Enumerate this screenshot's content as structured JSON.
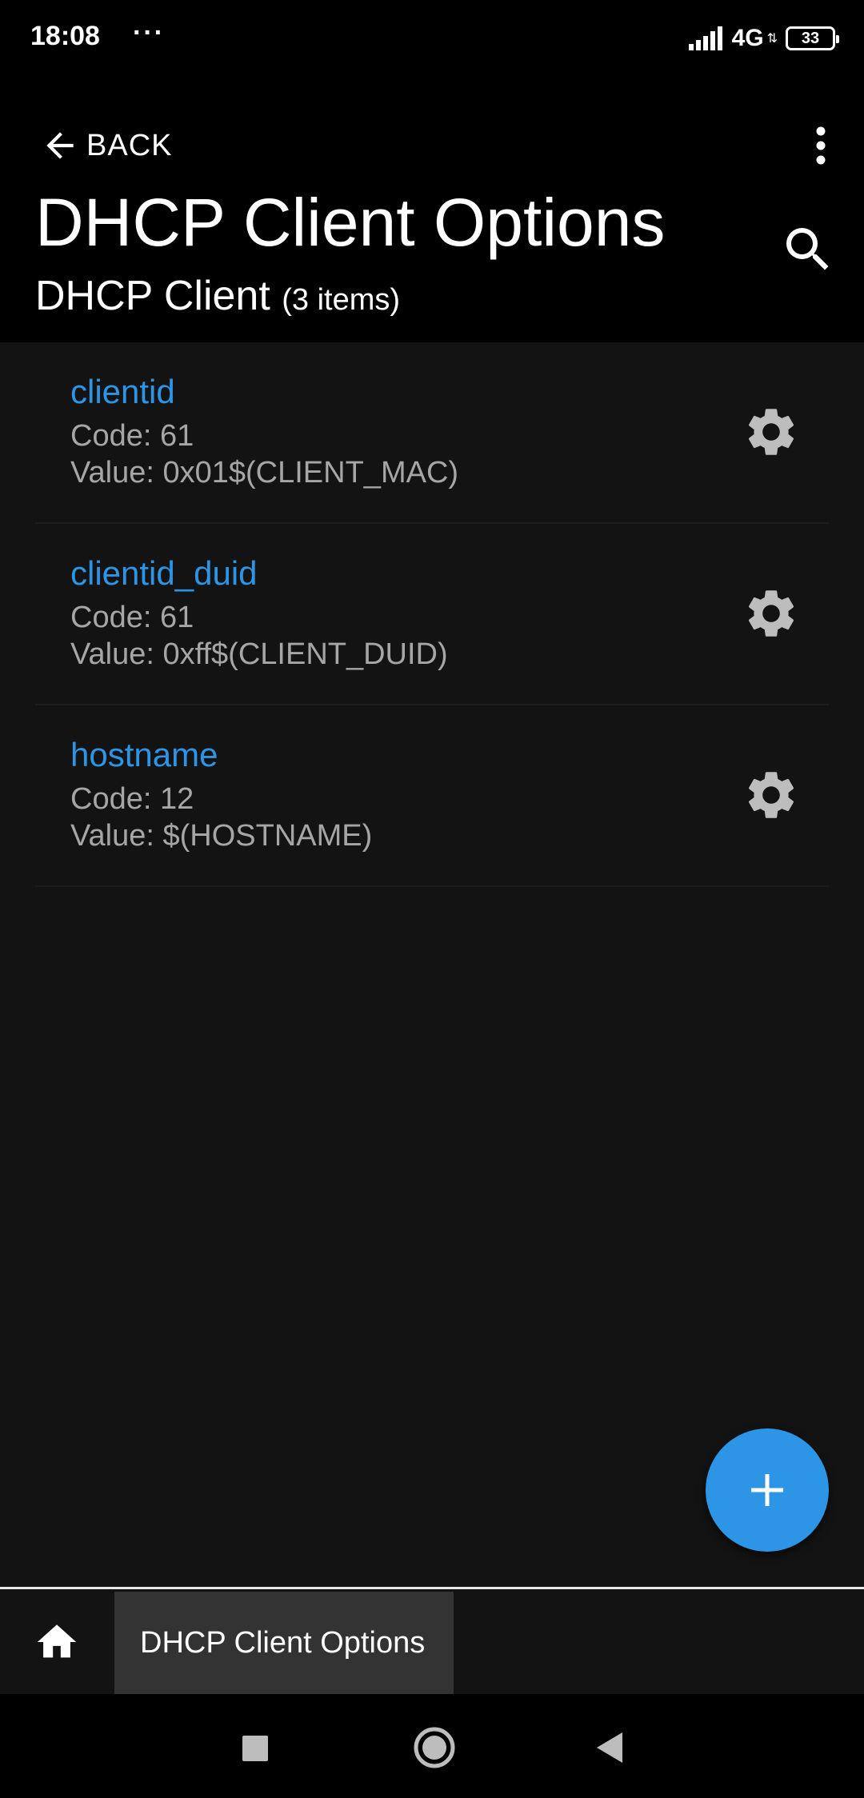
{
  "status_bar": {
    "time": "18:08",
    "dots": "···",
    "network": "4G",
    "battery": "33"
  },
  "header": {
    "back_label": "BACK",
    "title": "DHCP Client Options",
    "subtitle": "DHCP Client",
    "item_count": "(3 items)"
  },
  "options": [
    {
      "name": "clientid",
      "code": "Code: 61",
      "value": "Value: 0x01$(CLIENT_MAC)"
    },
    {
      "name": "clientid_duid",
      "code": "Code: 61",
      "value": "Value: 0xff$(CLIENT_DUID)"
    },
    {
      "name": "hostname",
      "code": "Code: 12",
      "value": "Value: $(HOSTNAME)"
    }
  ],
  "breadcrumb": {
    "current": "DHCP Client Options"
  },
  "colors": {
    "accent": "#2d95e6",
    "background": "#131313",
    "header": "#000000",
    "secondary_text": "#a6a6a6"
  },
  "icons": {
    "back": "arrow-left-icon",
    "menu": "overflow-menu-icon",
    "search": "search-icon",
    "settings": "gear-icon",
    "add": "plus-icon",
    "home": "home-icon"
  }
}
